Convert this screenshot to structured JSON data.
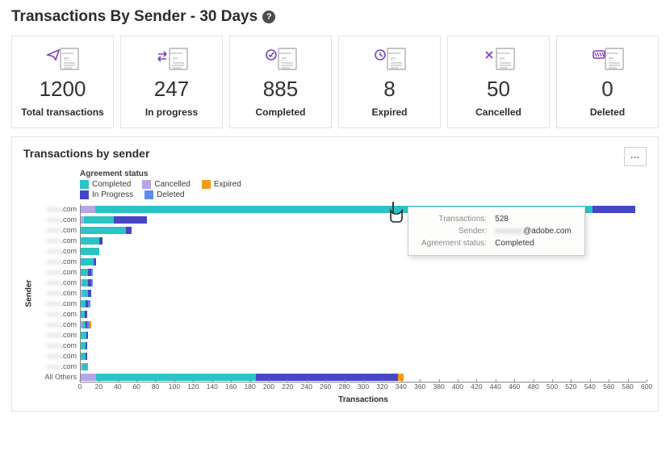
{
  "title": "Transactions By Sender - 30 Days",
  "cards": [
    {
      "label": "Total transactions",
      "value": "1200",
      "icon": "send"
    },
    {
      "label": "In progress",
      "value": "247",
      "icon": "progress"
    },
    {
      "label": "Completed",
      "value": "885",
      "icon": "completed"
    },
    {
      "label": "Expired",
      "value": "8",
      "icon": "expired"
    },
    {
      "label": "Cancelled",
      "value": "50",
      "icon": "cancelled"
    },
    {
      "label": "Deleted",
      "value": "0",
      "icon": "deleted"
    }
  ],
  "panel_title": "Transactions by sender",
  "legend_title": "Agreement status",
  "legend": [
    {
      "name": "Completed",
      "color": "#2bc4c4"
    },
    {
      "name": "Cancelled",
      "color": "#b6a6e9"
    },
    {
      "name": "Expired",
      "color": "#f29b1d"
    },
    {
      "name": "In Progress",
      "color": "#4646c6"
    },
    {
      "name": "Deleted",
      "color": "#5b8def"
    }
  ],
  "ylabel": "Sender",
  "xlabel": "Transactions",
  "tooltip": {
    "transactions_label": "Transactions:",
    "transactions_value": "528",
    "sender_label": "Sender:",
    "sender_value": "@adobe.com",
    "status_label": "Agreement status:",
    "status_value": "Completed"
  },
  "chart_data": {
    "type": "bar",
    "orientation": "horizontal",
    "stacked": true,
    "xlabel": "Transactions",
    "ylabel": "Sender",
    "xlim": [
      0,
      600
    ],
    "xticks": [
      0,
      20,
      40,
      60,
      80,
      100,
      120,
      140,
      160,
      180,
      200,
      220,
      240,
      260,
      280,
      300,
      320,
      340,
      360,
      380,
      400,
      420,
      440,
      460,
      480,
      500,
      520,
      540,
      560,
      580,
      600
    ],
    "categories": [
      ".com",
      ".com",
      ".com",
      ".com",
      ".com",
      ".com",
      ".com",
      ".com",
      ".com",
      ".com",
      ".com",
      ".com",
      ".com",
      ".com",
      ".com",
      ".com",
      "All Others"
    ],
    "statuses": [
      "Cancelled",
      "Completed",
      "In Progress",
      "Deleted",
      "Expired"
    ],
    "colors": {
      "Completed": "#2bc4c4",
      "Cancelled": "#b6a6e9",
      "Expired": "#f29b1d",
      "In Progress": "#4646c6",
      "Deleted": "#5b8def"
    },
    "series": [
      {
        "Cancelled": 15,
        "Completed": 528,
        "In Progress": 45
      },
      {
        "Cancelled": 3,
        "Completed": 32,
        "In Progress": 35
      },
      {
        "Completed": 48,
        "In Progress": 6
      },
      {
        "Completed": 20,
        "In Progress": 3
      },
      {
        "Completed": 20
      },
      {
        "Completed": 14,
        "In Progress": 2
      },
      {
        "Completed": 8,
        "In Progress": 3,
        "Deleted": 2
      },
      {
        "Cancelled": 2,
        "Completed": 6,
        "In Progress": 3,
        "Deleted": 2
      },
      {
        "Cancelled": 2,
        "Completed": 6,
        "In Progress": 3
      },
      {
        "Completed": 5,
        "In Progress": 3,
        "Deleted": 2
      },
      {
        "Completed": 4,
        "In Progress": 3
      },
      {
        "Cancelled": 2,
        "Completed": 3,
        "Expired": 2,
        "In Progress": 2,
        "Deleted": 2
      },
      {
        "Completed": 6,
        "In Progress": 2
      },
      {
        "Completed": 5,
        "In Progress": 2
      },
      {
        "Completed": 5,
        "In Progress": 2
      },
      {
        "Cancelled": 2,
        "Completed": 6
      },
      {
        "Cancelled": 16,
        "Completed": 170,
        "Expired": 6,
        "In Progress": 150
      }
    ]
  }
}
